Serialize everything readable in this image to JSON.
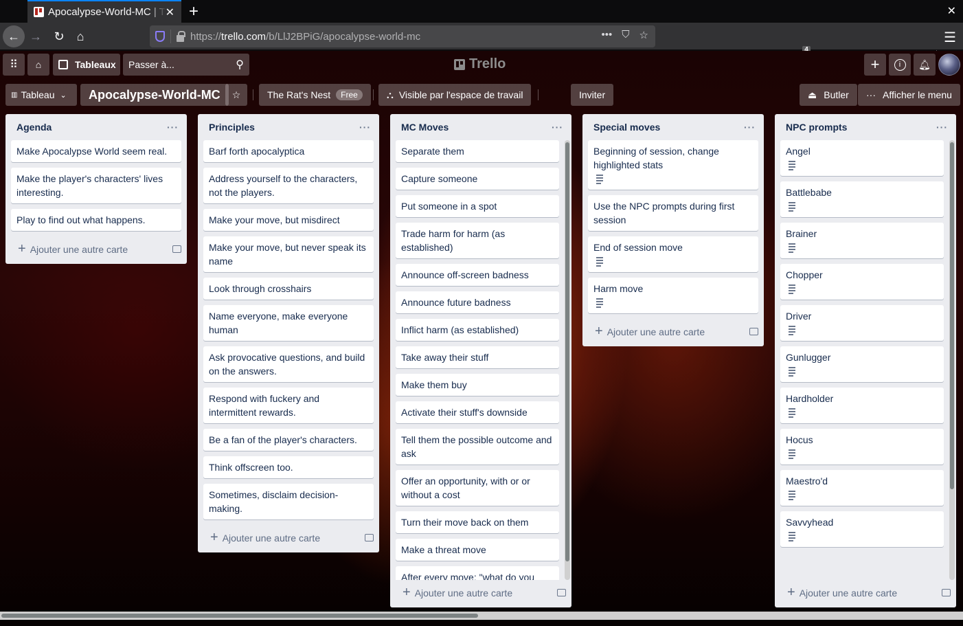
{
  "browser": {
    "tab_title": "Apocalypse-World-MC | Trello",
    "url_prefix": "https://",
    "url_host": "trello.com",
    "url_path": "/b/LlJ2BPiG/apocalypse-world-mc",
    "extension_badge": "4",
    "accent": "#0a84ff"
  },
  "topbar": {
    "boards_label": "Tableaux",
    "search_placeholder": "Passer à...",
    "logo_text": "Trello"
  },
  "boardbar": {
    "view_label": "Tableau",
    "board_name": "Apocalypse-World-MC",
    "workspace_name": "The Rat's Nest",
    "workspace_plan": "Free",
    "visibility_label": "Visible par l'espace de travail",
    "invite_label": "Inviter",
    "butler_label": "Butler",
    "menu_label": "Afficher le menu"
  },
  "add_card_label": "Ajouter une autre carte",
  "lists": [
    {
      "title": "Agenda",
      "cards": [
        {
          "text": "Make Apocalypse World seem real.",
          "desc": false
        },
        {
          "text": "Make the player's characters' lives interesting.",
          "desc": false
        },
        {
          "text": "Play to find out what happens.",
          "desc": false
        }
      ]
    },
    {
      "title": "Principles",
      "cards": [
        {
          "text": "Barf forth apocalyptica",
          "desc": false
        },
        {
          "text": "Address yourself to the characters, not the players.",
          "desc": false
        },
        {
          "text": "Make your move, but misdirect",
          "desc": false
        },
        {
          "text": "Make your move, but never speak its name",
          "desc": false
        },
        {
          "text": "Look through crosshairs",
          "desc": false
        },
        {
          "text": "Name everyone, make everyone human",
          "desc": false
        },
        {
          "text": "Ask provocative questions, and build on the answers.",
          "desc": false
        },
        {
          "text": "Respond with fuckery and intermittent rewards.",
          "desc": false
        },
        {
          "text": "Be a fan of the player's characters.",
          "desc": false
        },
        {
          "text": "Think offscreen too.",
          "desc": false
        },
        {
          "text": "Sometimes, disclaim decision-making.",
          "desc": false
        }
      ]
    },
    {
      "title": "MC Moves",
      "cards": [
        {
          "text": "Separate them",
          "desc": false
        },
        {
          "text": "Capture someone",
          "desc": false
        },
        {
          "text": "Put someone in a spot",
          "desc": false
        },
        {
          "text": "Trade harm for harm (as established)",
          "desc": false
        },
        {
          "text": "Announce off-screen badness",
          "desc": false
        },
        {
          "text": "Announce future badness",
          "desc": false
        },
        {
          "text": "Inflict harm (as established)",
          "desc": false
        },
        {
          "text": "Take away their stuff",
          "desc": false
        },
        {
          "text": "Make them buy",
          "desc": false
        },
        {
          "text": "Activate their stuff's downside",
          "desc": false
        },
        {
          "text": "Tell them the possible outcome and ask",
          "desc": false
        },
        {
          "text": "Offer an opportunity, with or or without a cost",
          "desc": false
        },
        {
          "text": "Turn their move back on them",
          "desc": false
        },
        {
          "text": "Make a threat move",
          "desc": false
        },
        {
          "text": "After every move: \"what do you do?\"",
          "desc": false
        }
      ]
    },
    {
      "title": "Special moves",
      "cards": [
        {
          "text": "Beginning of session, change highlighted stats",
          "desc": true
        },
        {
          "text": "Use the NPC prompts during first session",
          "desc": false
        },
        {
          "text": "End of session move",
          "desc": true
        },
        {
          "text": "Harm move",
          "desc": true
        }
      ]
    },
    {
      "title": "NPC prompts",
      "cards": [
        {
          "text": "Angel",
          "desc": true
        },
        {
          "text": "Battlebabe",
          "desc": true
        },
        {
          "text": "Brainer",
          "desc": true
        },
        {
          "text": "Chopper",
          "desc": true
        },
        {
          "text": "Driver",
          "desc": true
        },
        {
          "text": "Gunlugger",
          "desc": true
        },
        {
          "text": "Hardholder",
          "desc": true
        },
        {
          "text": "Hocus",
          "desc": true
        },
        {
          "text": "Maestro'd",
          "desc": true
        },
        {
          "text": "Savvyhead",
          "desc": true
        }
      ]
    }
  ]
}
